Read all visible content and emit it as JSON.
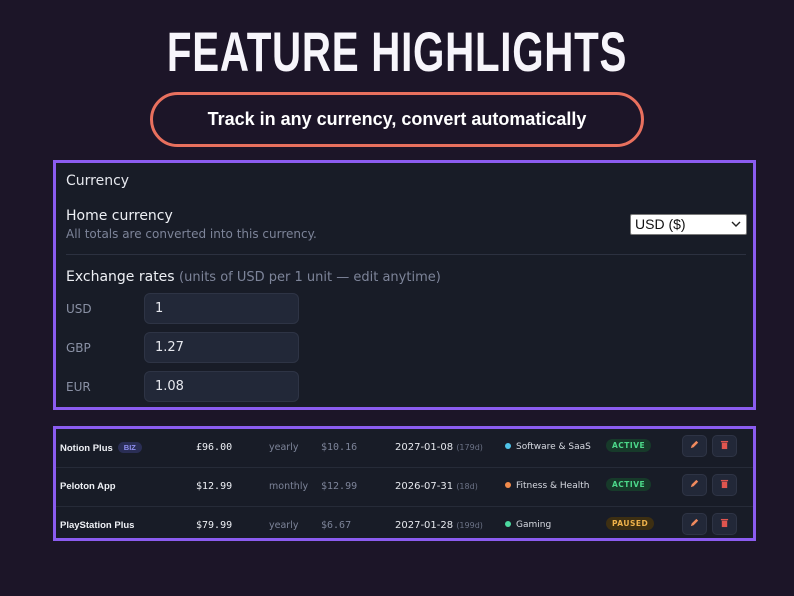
{
  "heading": "FEATURE HIGHLIGHTS",
  "tagline": "Track in any currency, convert automatically",
  "currency": {
    "title": "Currency",
    "home_label": "Home currency",
    "home_desc": "All totals are converted into this currency.",
    "home_selected": "USD ($)",
    "rates_label": "Exchange rates",
    "rates_hint": "(units of USD per 1 unit — edit anytime)",
    "rates": [
      {
        "code": "USD",
        "value": "1"
      },
      {
        "code": "GBP",
        "value": "1.27"
      },
      {
        "code": "EUR",
        "value": "1.08"
      }
    ]
  },
  "subscriptions": [
    {
      "name": "Notion Plus",
      "badge": "BIZ",
      "price": "£96.00",
      "cycle": "yearly",
      "monthly": "$10.16",
      "renewal": "2027-01-08",
      "days": "(179d)",
      "category": "Software & SaaS",
      "category_color": "#4fc3e8",
      "status": "ACTIVE",
      "status_bg": "#173a2a",
      "status_fg": "#4cd98a"
    },
    {
      "name": "Peloton App",
      "badge": "",
      "price": "$12.99",
      "cycle": "monthly",
      "monthly": "$12.99",
      "renewal": "2026-07-31",
      "days": "(18d)",
      "category": "Fitness & Health",
      "category_color": "#f08a4b",
      "status": "ACTIVE",
      "status_bg": "#173a2a",
      "status_fg": "#4cd98a"
    },
    {
      "name": "PlayStation Plus",
      "badge": "",
      "price": "$79.99",
      "cycle": "yearly",
      "monthly": "$6.67",
      "renewal": "2027-01-28",
      "days": "(199d)",
      "category": "Gaming",
      "category_color": "#4cd9a0",
      "status": "PAUSED",
      "status_bg": "#3d2f12",
      "status_fg": "#f0b34b"
    }
  ],
  "colors": {
    "accent": "#8b5cf0",
    "pill_border": "#e8705e",
    "edit_icon": "#f08a5e",
    "delete_icon": "#e0554f"
  },
  "icons": {
    "edit": "pencil-icon",
    "delete": "trash-icon"
  }
}
